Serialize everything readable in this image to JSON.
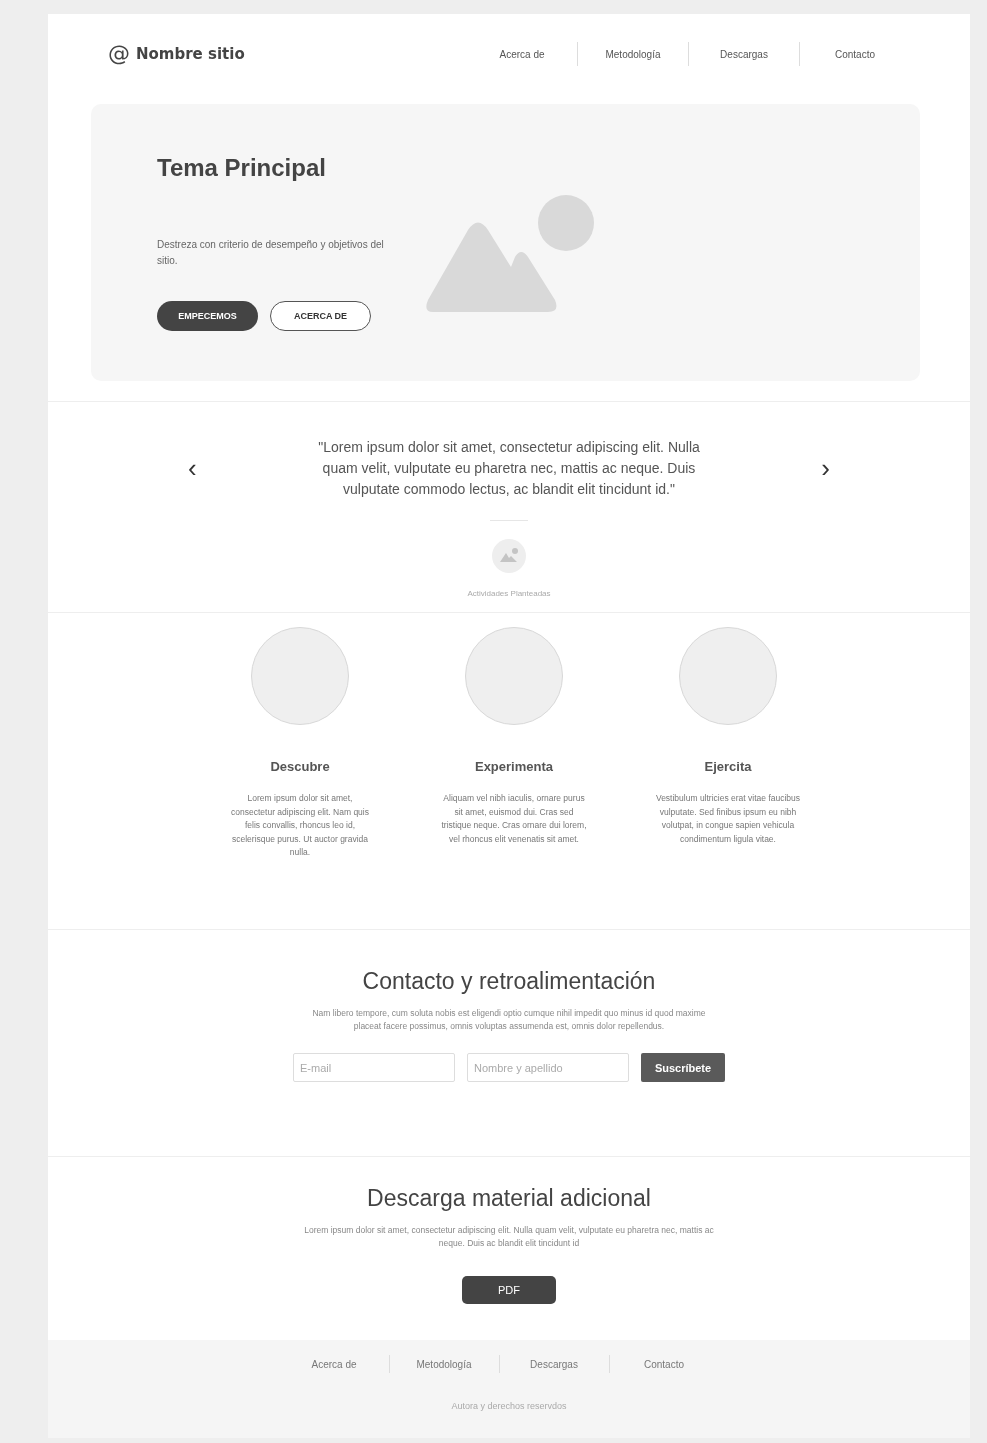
{
  "header": {
    "logo_mark": "@",
    "site_name": "Nombre sitio",
    "nav": [
      "Acerca de",
      "Metodología",
      "Descargas",
      "Contacto"
    ]
  },
  "hero": {
    "title": "Tema Principal",
    "description": "Destreza con criterio de desempeño y objetivos del sitio.",
    "buttons": [
      {
        "label": "EMPECEMOS",
        "kind": "filled"
      },
      {
        "label": "ACERCA DE",
        "kind": "outline"
      }
    ]
  },
  "testimonial": {
    "prev": "‹",
    "next": "›",
    "quote": "\"Lorem ipsum dolor sit amet, consectetur adipiscing elit. Nulla quam velit, vulputate eu pharetra nec, mattis ac neque. Duis vulputate commodo lectus, ac blandit elit tincidunt id.\"",
    "caption": "Actividades Planteadas"
  },
  "features": [
    {
      "title": "Descubre",
      "text": "Lorem ipsum dolor sit amet, consectetur adipiscing elit. Nam quis felis convallis, rhoncus leo id, scelerisque purus. Ut auctor gravida nulla."
    },
    {
      "title": "Experimenta",
      "text": "Aliquam vel nibh iaculis, ornare purus sit amet, euismod dui. Cras sed tristique neque. Cras ornare dui lorem, vel rhoncus elit venenatis sit amet."
    },
    {
      "title": "Ejercita",
      "text": "Vestibulum ultricies erat vitae faucibus vulputate. Sed finibus ipsum eu nibh volutpat, in congue sapien vehicula condimentum ligula vitae."
    }
  ],
  "contact": {
    "title": "Contacto y retroalimentación",
    "text": "Nam libero tempore, cum soluta nobis est eligendi optio cumque nihil impedit quo minus id quod maxime placeat facere possimus, omnis voluptas assumenda est, omnis dolor repellendus.",
    "fields": [
      {
        "placeholder": "E-mail"
      },
      {
        "placeholder": "Nombre y apellido"
      }
    ],
    "button": "Suscríbete"
  },
  "download": {
    "title": "Descarga material adicional",
    "text": "Lorem ipsum dolor sit amet, consectetur adipiscing elit. Nulla quam velit, vulputate eu pharetra nec, mattis ac neque. Duis ac blandit elit tincidunt id",
    "button": "PDF"
  },
  "footer": {
    "nav": [
      "Acerca de",
      "Metodología",
      "Descargas",
      "Contacto"
    ],
    "copyright": "Autora y derechos reservdos"
  }
}
